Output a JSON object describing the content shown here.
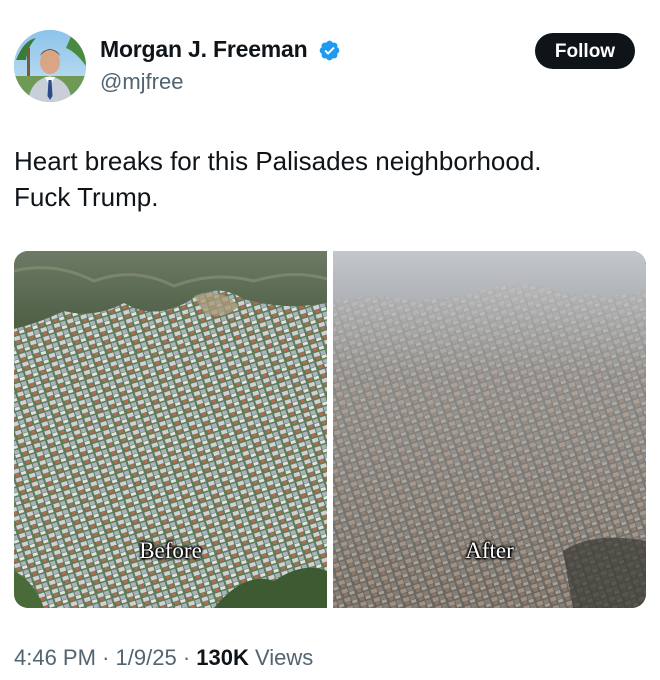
{
  "author": {
    "name": "Morgan J. Freeman",
    "handle": "@mjfree",
    "verified": true
  },
  "follow_button": {
    "label": "Follow"
  },
  "tweet": {
    "lines": [
      "Heart breaks for this Palisades neighborhood.",
      "Fuck Trump."
    ]
  },
  "media": {
    "before_label": "Before",
    "after_label": "After"
  },
  "meta": {
    "time": "4:46 PM",
    "separator": "·",
    "date": "1/9/25",
    "views_count": "130K",
    "views_label": "Views"
  },
  "colors": {
    "text_primary": "#0f1419",
    "text_secondary": "#536471",
    "verified_blue": "#1d9bf0",
    "button_bg": "#0f1419"
  },
  "icons": {
    "verified": "verified-badge-icon"
  }
}
